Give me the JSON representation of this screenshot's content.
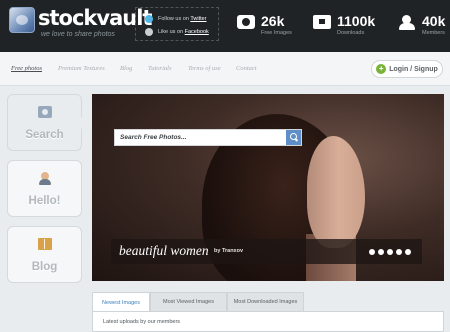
{
  "header": {
    "logo_text": "stockvault",
    "tagline": "we love to share photos",
    "follow": {
      "twitter_prefix": "Follow us on ",
      "twitter_link": "Twitter",
      "facebook_prefix": "Like us on ",
      "facebook_link": "Facebook"
    },
    "stats": [
      {
        "value": "26k",
        "label": "Free Images",
        "icon": "camera-icon"
      },
      {
        "value": "1100k",
        "label": "Downloads",
        "icon": "download-icon"
      },
      {
        "value": "40k",
        "label": "Members",
        "icon": "members-icon"
      }
    ]
  },
  "nav": {
    "items": [
      "Free photos",
      "Premium Textures",
      "Blog",
      "Tutorials",
      "Terms of use",
      "Contact"
    ],
    "active": "Free photos",
    "login_label": "Login / Signup"
  },
  "side": {
    "search_label": "Search",
    "hello_label": "Hello!",
    "blog_label": "Blog"
  },
  "hero": {
    "search_placeholder": "Search Free Photos...",
    "caption_title": "beautiful women",
    "caption_by": "by Tranxov",
    "slide_count": 5
  },
  "tabs": {
    "items": [
      "Newest Images",
      "Most Viewed Images",
      "Most Downloaded Images"
    ],
    "active": "Newest Images",
    "panel_text": "Latest uploads by our members"
  },
  "colors": {
    "header_bg": "#1f2325",
    "accent_blue": "#3e80c0",
    "login_green": "#79b23a",
    "twitter_blue": "#4fb7e5"
  }
}
